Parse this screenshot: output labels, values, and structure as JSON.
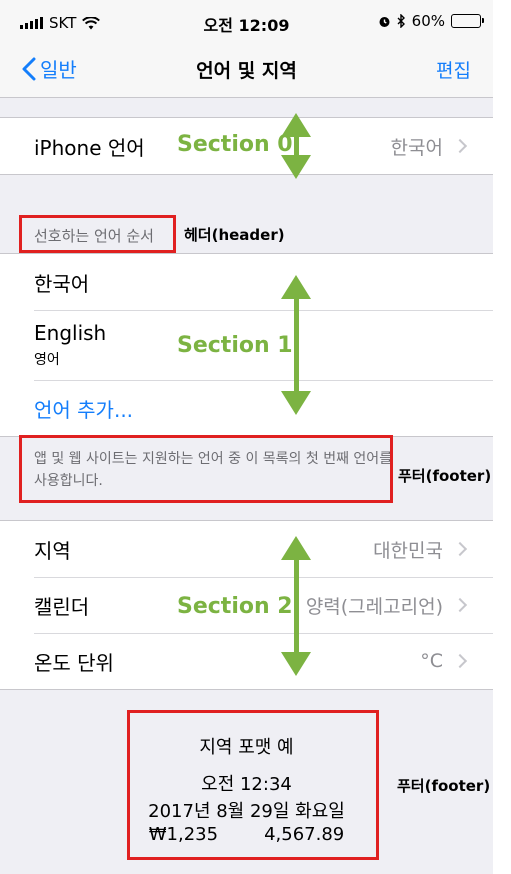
{
  "status_bar": {
    "carrier": "SKT",
    "time": "오전 12:09",
    "battery": "60%",
    "battery_level": 0.6
  },
  "nav": {
    "back_label": "일반",
    "title": "언어 및 지역",
    "edit_label": "편집"
  },
  "section0": {
    "iphone_language": {
      "title": "iPhone 언어",
      "value": "한국어"
    }
  },
  "section1": {
    "header": "선호하는 언어 순서",
    "languages": [
      {
        "title": "한국어"
      },
      {
        "title": "English",
        "subtitle": "영어"
      }
    ],
    "add_language": "언어 추가...",
    "footer": "앱 및 웹 사이트는 지원하는 언어 중 이 목록의 첫 번째 언어를 사용합니다."
  },
  "section2": {
    "rows": [
      {
        "title": "지역",
        "value": "대한민국"
      },
      {
        "title": "캘린더",
        "value": "양력(그레고리언)"
      },
      {
        "title": "온도 단위",
        "value": "°C"
      }
    ],
    "footer": {
      "heading": "지역 포맷 예",
      "time": "오전 12:34",
      "date": "2017년 8월 29일 화요일",
      "currency": "₩1,235",
      "number": "4,567.89"
    }
  },
  "annotations": {
    "section0": "Section 0",
    "section1": "Section 1",
    "section2": "Section 2",
    "header_label": "헤더(header)",
    "footer_label1": "푸터(footer)",
    "footer_label2": "푸터(footer)"
  },
  "colors": {
    "tint": "#147efb",
    "annotation_green": "#7cb342",
    "annotation_red": "#e02020",
    "background": "#efeff4"
  }
}
